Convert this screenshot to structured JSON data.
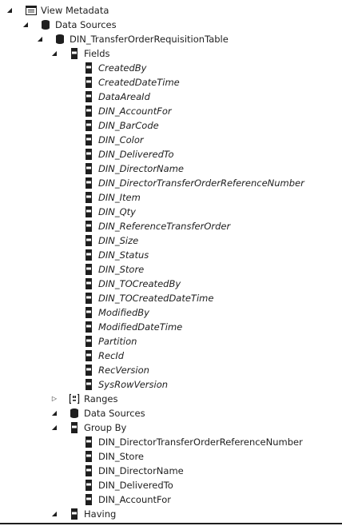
{
  "view_metadata": {
    "label": "View Metadata",
    "data_sources": {
      "label": "Data Sources",
      "table": {
        "label": "DIN_TransferOrderRequisitionTable",
        "fields": {
          "label": "Fields",
          "items": [
            "CreatedBy",
            "CreatedDateTime",
            "DataAreaId",
            "DIN_AccountFor",
            "DIN_BarCode",
            "DIN_Color",
            "DIN_DeliveredTo",
            "DIN_DirectorName",
            "DIN_DirectorTransferOrderReferenceNumber",
            "DIN_Item",
            "DIN_Qty",
            "DIN_ReferenceTransferOrder",
            "DIN_Size",
            "DIN_Status",
            "DIN_Store",
            "DIN_TOCreatedBy",
            "DIN_TOCreatedDateTime",
            "ModifiedBy",
            "ModifiedDateTime",
            "Partition",
            "RecId",
            "RecVersion",
            "SysRowVersion"
          ]
        },
        "ranges": {
          "label": "Ranges"
        },
        "data_sources": {
          "label": "Data Sources"
        },
        "group_by": {
          "label": "Group By",
          "items": [
            "DIN_DirectorTransferOrderReferenceNumber",
            "DIN_Store",
            "DIN_DirectorName",
            "DIN_DeliveredTo",
            "DIN_AccountFor"
          ]
        },
        "having": {
          "label": "Having"
        }
      }
    }
  },
  "glyphs": {
    "expanded": "◢",
    "collapsed": "▷"
  },
  "colors": {
    "text": "#1e1e1e",
    "hover": "#e5f1fb"
  }
}
